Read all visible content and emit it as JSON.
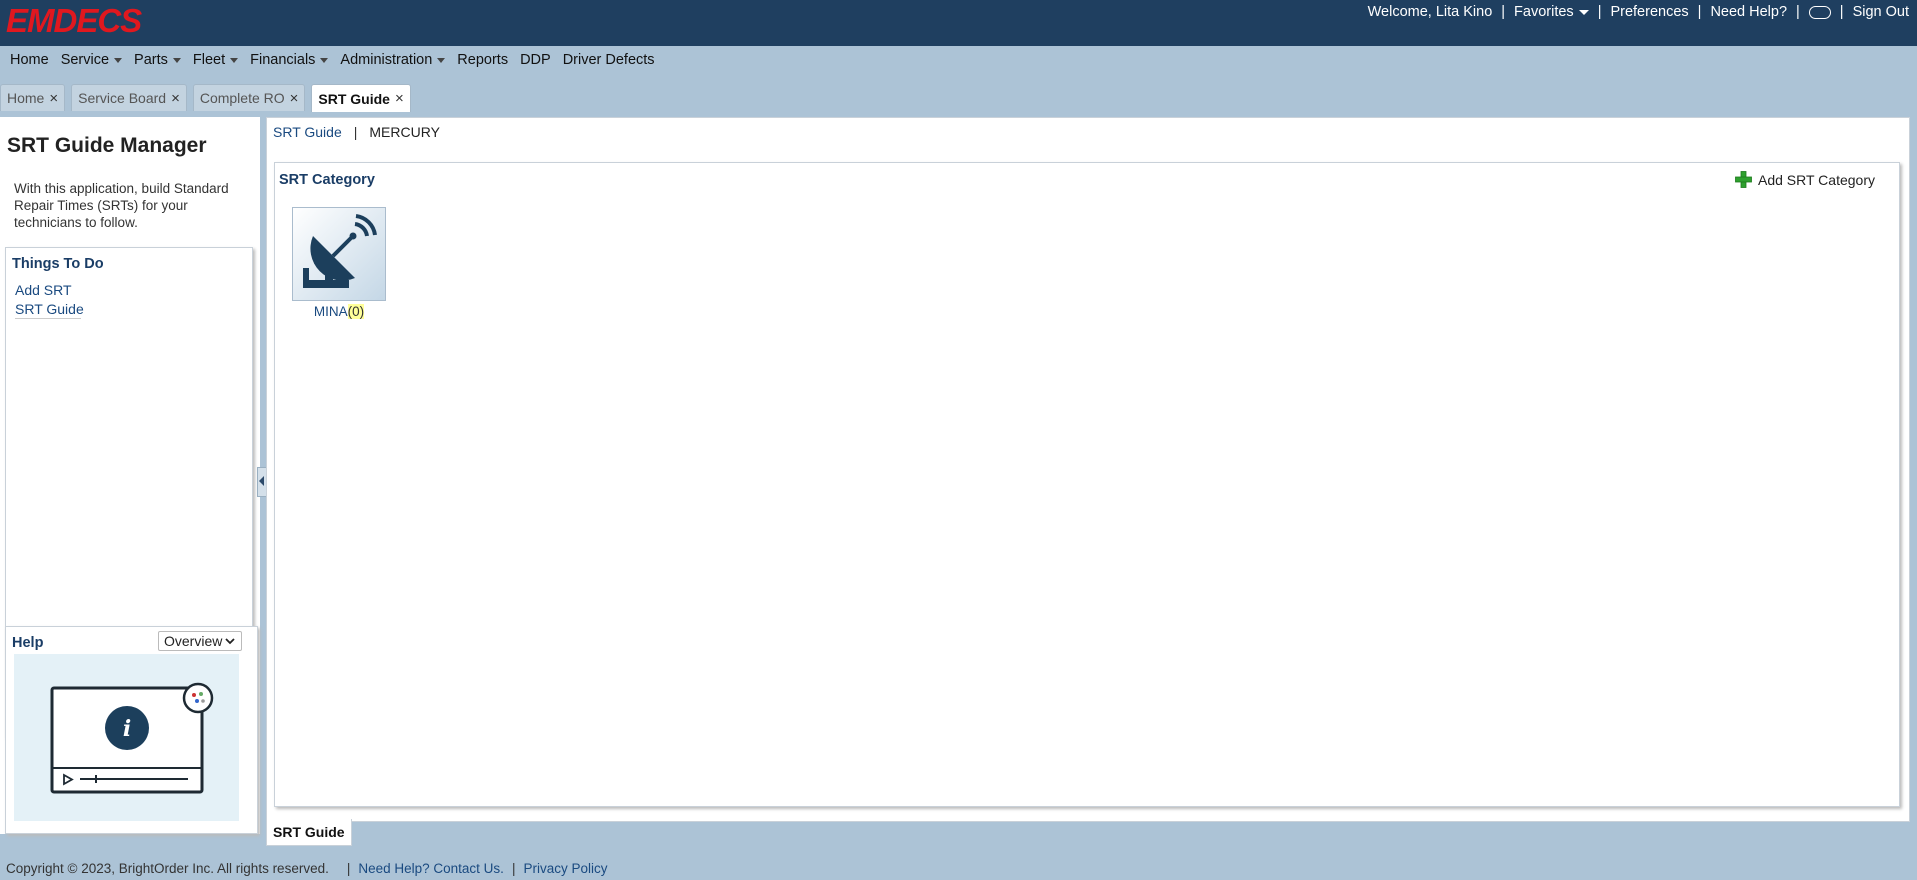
{
  "header": {
    "logo_text": "EMDECS",
    "welcome": "Welcome, Lita Kino",
    "favorites": "Favorites",
    "preferences": "Preferences",
    "need_help": "Need Help?",
    "sign_out": "Sign Out",
    "separator": "|"
  },
  "nav": {
    "items": [
      {
        "label": "Home",
        "dropdown": false
      },
      {
        "label": "Service",
        "dropdown": true
      },
      {
        "label": "Parts",
        "dropdown": true
      },
      {
        "label": "Fleet",
        "dropdown": true
      },
      {
        "label": "Financials",
        "dropdown": true
      },
      {
        "label": "Administration",
        "dropdown": true
      },
      {
        "label": "Reports",
        "dropdown": false
      },
      {
        "label": "DDP",
        "dropdown": false
      },
      {
        "label": "Driver Defects",
        "dropdown": false
      }
    ]
  },
  "tabs": [
    {
      "label": "Home",
      "active": false
    },
    {
      "label": "Service Board",
      "active": false
    },
    {
      "label": "Complete RO",
      "active": false
    },
    {
      "label": "SRT Guide",
      "active": true
    }
  ],
  "tab_close_glyph": "×",
  "left_panel": {
    "title": "SRT Guide Manager",
    "intro": "With this application, build Standard Repair Times (SRTs) for your technicians to follow.",
    "things_to_do": {
      "title": "Things To Do",
      "links": [
        "Add SRT",
        "SRT Guide"
      ]
    },
    "help": {
      "title": "Help",
      "selected_option": "Overview"
    }
  },
  "main": {
    "breadcrumb": {
      "root": "SRT Guide",
      "separator": "|",
      "current": "MERCURY"
    },
    "category_panel": {
      "title": "SRT Category",
      "add_label": "Add SRT Category",
      "tiles": [
        {
          "name": "MINA",
          "count": "(0)",
          "icon": "satellite-dish-icon"
        }
      ]
    },
    "bottom_tab": "SRT Guide"
  },
  "footer": {
    "copyright": "Copyright © 2023, BrightOrder Inc. All rights reserved.",
    "contact": "Need Help? Contact Us.",
    "privacy": "Privacy Policy",
    "separator": "|"
  },
  "colors": {
    "topbar": "#1f3f60",
    "logo": "#e0181f",
    "background": "#acc3d6",
    "link": "#1a4a80",
    "heading": "#1a3d66",
    "add_plus": "#2ea02e",
    "dish": "#1c3f5c"
  }
}
